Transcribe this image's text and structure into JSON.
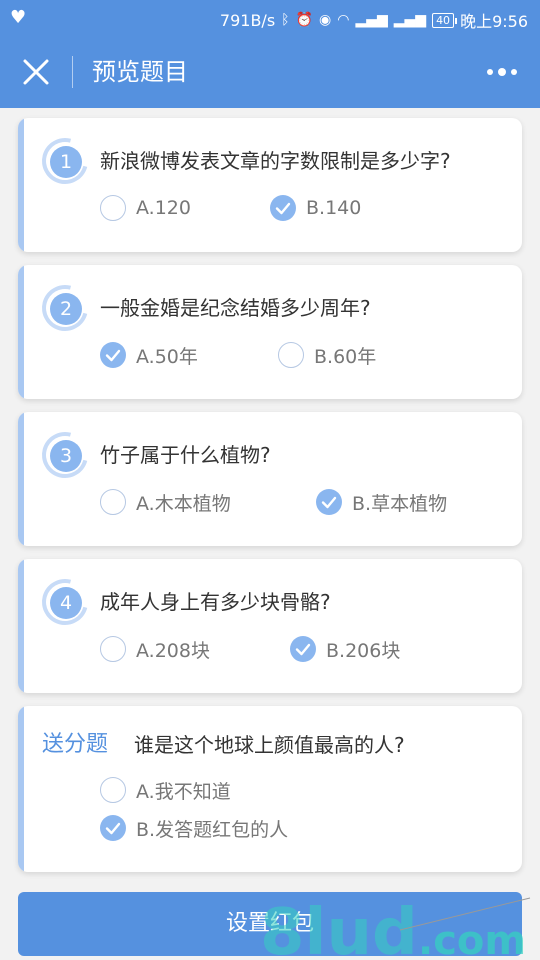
{
  "status_bar": {
    "speed": "791B/s",
    "battery": "40",
    "time": "晚上9:56"
  },
  "nav": {
    "title": "预览题目"
  },
  "questions": [
    {
      "number": "1",
      "text": "新浪微博发表文章的字数限制是多少字?",
      "options": [
        {
          "label": "A.120",
          "selected": false
        },
        {
          "label": "B.140",
          "selected": true
        }
      ]
    },
    {
      "number": "2",
      "text": "一般金婚是纪念结婚多少周年?",
      "options": [
        {
          "label": "A.50年",
          "selected": true
        },
        {
          "label": "B.60年",
          "selected": false
        }
      ]
    },
    {
      "number": "3",
      "text": "竹子属于什么植物?",
      "options": [
        {
          "label": "A.木本植物",
          "selected": false
        },
        {
          "label": "B.草本植物",
          "selected": true
        }
      ]
    },
    {
      "number": "4",
      "text": "成年人身上有多少块骨骼?",
      "options": [
        {
          "label": "A.208块",
          "selected": false
        },
        {
          "label": "B.206块",
          "selected": true
        }
      ]
    }
  ],
  "bonus": {
    "tag": "送分题",
    "text": "谁是这个地球上颜值最高的人?",
    "options": [
      {
        "label": "A.我不知道",
        "selected": false
      },
      {
        "label": "B.发答题红包的人",
        "selected": true
      }
    ]
  },
  "action_button": "设置红包",
  "colors": {
    "primary": "#5591df",
    "badge": "#8ab6ef",
    "card_accent": "#a9c8f2",
    "watermark": "#35d0c0"
  }
}
